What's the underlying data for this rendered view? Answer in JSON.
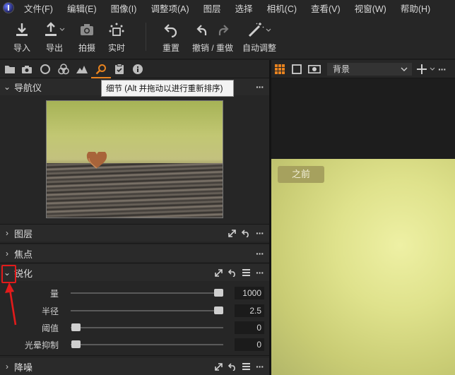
{
  "menubar": {
    "items": [
      "文件(F)",
      "编辑(E)",
      "图像(I)",
      "调整项(A)",
      "图层",
      "选择",
      "相机(C)",
      "查看(V)",
      "视窗(W)",
      "帮助(H)"
    ]
  },
  "toolbar": {
    "import": "导入",
    "export": "导出",
    "capture": "拍摄",
    "live": "实时",
    "reset": "重置",
    "undo_redo": "撤销 / 重做",
    "auto_adjust": "自动调整"
  },
  "tooltip": "细节 (Alt 并拖动以进行重新排序)",
  "panels": {
    "navigator": "导航仪",
    "layers": "图层",
    "focus": "焦点",
    "sharpen": "锐化",
    "noise": "降噪"
  },
  "sharpen": {
    "rows": [
      {
        "label": "量",
        "value": "1000",
        "fraction": 1.0
      },
      {
        "label": "半径",
        "value": "2.5",
        "fraction": 1.0
      },
      {
        "label": "阈值",
        "value": "0",
        "fraction": 0.0
      },
      {
        "label": "光晕抑制",
        "value": "0",
        "fraction": 0.0
      }
    ]
  },
  "viewer": {
    "layer_select": "背景",
    "before_label": "之前"
  },
  "colors": {
    "accent": "#e8831f",
    "highlight": "#e21b1b"
  },
  "icons": [
    "folder-icon",
    "camera-icon",
    "circle-icon",
    "color-icon",
    "exposure-icon",
    "details-icon",
    "metadata-icon",
    "info-icon"
  ]
}
